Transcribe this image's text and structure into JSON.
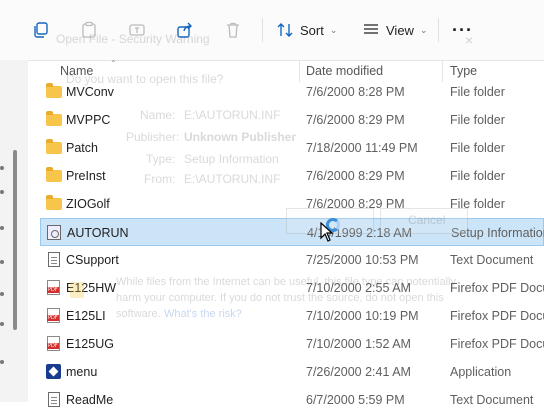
{
  "toolbar": {
    "sort_label": "Sort",
    "view_label": "View",
    "more_label": "···"
  },
  "columns": {
    "name": "Name",
    "date_modified": "Date modified",
    "type": "Type"
  },
  "files": [
    {
      "name": "MVConv",
      "date": "7/6/2000 8:28 PM",
      "type": "File folder",
      "icon": "folder-icon"
    },
    {
      "name": "MVPPC",
      "date": "7/6/2000 8:29 PM",
      "type": "File folder",
      "icon": "folder-icon"
    },
    {
      "name": "Patch",
      "date": "7/18/2000 11:49 PM",
      "type": "File folder",
      "icon": "folder-icon"
    },
    {
      "name": "PreInst",
      "date": "7/6/2000 8:29 PM",
      "type": "File folder",
      "icon": "folder-icon"
    },
    {
      "name": "ZIOGolf",
      "date": "7/6/2000 8:29 PM",
      "type": "File folder",
      "icon": "folder-icon"
    },
    {
      "name": "AUTORUN",
      "date": "4/10/1999 2:18 AM",
      "type": "Setup Information",
      "icon": "setup-info-icon",
      "selected": true
    },
    {
      "name": "CSupport",
      "date": "7/25/2000 10:53 PM",
      "type": "Text Document",
      "icon": "text-document-icon"
    },
    {
      "name": "E125HW",
      "date": "7/10/2000 2:55 AM",
      "type": "Firefox PDF Docu...",
      "icon": "pdf-icon"
    },
    {
      "name": "E125LI",
      "date": "7/10/2000 10:19 PM",
      "type": "Firefox PDF Docu...",
      "icon": "pdf-icon"
    },
    {
      "name": "E125UG",
      "date": "7/10/2000 1:52 AM",
      "type": "Firefox PDF Docu...",
      "icon": "pdf-icon"
    },
    {
      "name": "menu",
      "date": "7/26/2000 2:41 AM",
      "type": "Application",
      "icon": "application-icon"
    },
    {
      "name": "ReadMe",
      "date": "6/7/2000 5:59 PM",
      "type": "Text Document",
      "icon": "text-document-icon"
    }
  ],
  "ghost_dialog": {
    "title": "Open File - Security Warning",
    "question": "Do you want to open this file?",
    "name_label": "Name:",
    "name_value": "E:\\AUTORUN.INF",
    "publisher_label": "Publisher:",
    "publisher_value": "Unknown Publisher",
    "type_label": "Type:",
    "type_value": "Setup Information",
    "from_label": "From:",
    "from_value": "E:\\AUTORUN.INF",
    "cancel_label": "Cancel",
    "warning_line1": "While files from the Internet can be useful, this file type can potentially",
    "warning_line2": "harm your computer. If you do not trust the source, do not open this",
    "warning_line3": "software.",
    "risk_link": "What's the risk?",
    "close_glyph": "×"
  }
}
